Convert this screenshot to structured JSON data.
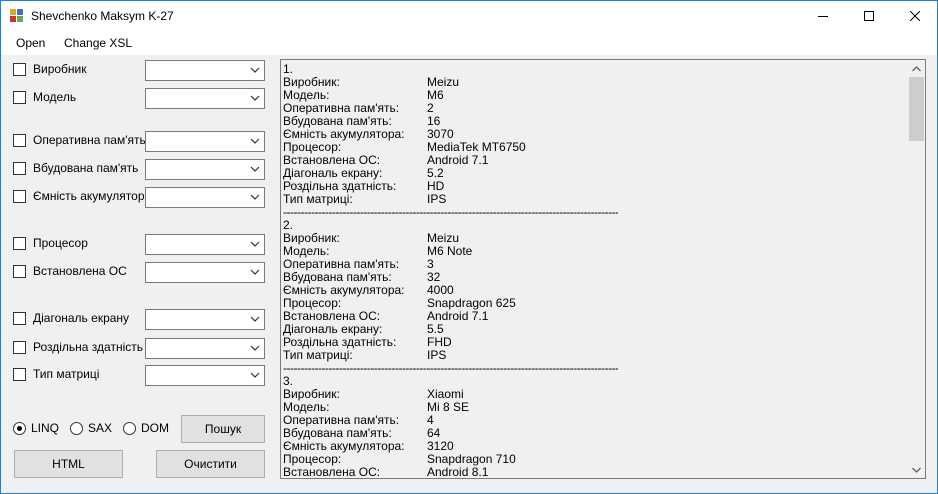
{
  "window": {
    "title": "Shevchenko Maksym K-27",
    "colors": {
      "border": "#1883d7",
      "client_bg": "#f0f0f0",
      "button_bg": "#e1e1e1"
    }
  },
  "menu": {
    "items": [
      "Open",
      "Change XSL"
    ]
  },
  "filters": [
    {
      "label": "Виробник",
      "checked": false,
      "value": ""
    },
    {
      "label": "Модель",
      "checked": false,
      "value": ""
    },
    {
      "label": "Оперативна пам'ять",
      "checked": false,
      "value": ""
    },
    {
      "label": "Вбудована пам'ять",
      "checked": false,
      "value": ""
    },
    {
      "label": "Ємність акумулятора",
      "checked": false,
      "value": ""
    },
    {
      "label": "Процесор",
      "checked": false,
      "value": ""
    },
    {
      "label": "Встановлена ОС",
      "checked": false,
      "value": ""
    },
    {
      "label": "Діагональ екрану",
      "checked": false,
      "value": ""
    },
    {
      "label": "Роздільна здатність",
      "checked": false,
      "value": ""
    },
    {
      "label": "Тип матриці",
      "checked": false,
      "value": ""
    }
  ],
  "parser_options": [
    {
      "label": "LINQ",
      "checked": true
    },
    {
      "label": "SAX",
      "checked": false
    },
    {
      "label": "DOM",
      "checked": false
    }
  ],
  "buttons": {
    "search": "Пошук",
    "html": "HTML",
    "clear": "Очистити"
  },
  "field_names": [
    "Виробник:",
    "Модель:",
    "Оперативна пам'ять:",
    "Вбудована пам'ять:",
    "Ємність акумулятора:",
    "Процесор:",
    "Встановлена ОС:",
    "Діагональ екрану:",
    "Роздільна здатність:",
    "Тип матриці:"
  ],
  "separator": "----------------------------------------------------------------------------------------------------------------------",
  "results": [
    {
      "number": "1.",
      "values": [
        "Meizu",
        "M6",
        "2",
        "16",
        "3070",
        "MediaTek MT6750",
        "Android 7.1",
        "5.2",
        "HD",
        "IPS"
      ]
    },
    {
      "number": "2.",
      "values": [
        "Meizu",
        "M6 Note",
        "3",
        "32",
        "4000",
        "Snapdragon 625",
        "Android 7.1",
        "5.5",
        "FHD",
        "IPS"
      ]
    },
    {
      "number": "3.",
      "values": [
        "Xiaomi",
        "Mi 8 SE",
        "4",
        "64",
        "3120",
        "Snapdragon 710",
        "Android 8.1"
      ]
    }
  ]
}
